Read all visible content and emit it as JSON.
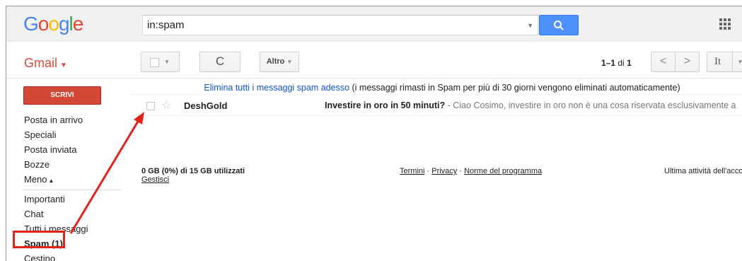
{
  "header": {
    "logo_letters": [
      {
        "ch": "G",
        "color": "#4285f4"
      },
      {
        "ch": "o",
        "color": "#ea4335"
      },
      {
        "ch": "o",
        "color": "#fbbc05"
      },
      {
        "ch": "g",
        "color": "#4285f4"
      },
      {
        "ch": "l",
        "color": "#34a853"
      },
      {
        "ch": "e",
        "color": "#ea4335"
      }
    ],
    "search_value": "in:spam",
    "search_icon": "search-icon",
    "apps_icon": "apps-grid-icon"
  },
  "toolbar": {
    "gmail_label": "Gmail",
    "refresh_glyph": "C",
    "altro_label": "Altro",
    "pager_range": "1–1",
    "pager_of": "di",
    "pager_total": "1",
    "prev_glyph": "<",
    "next_glyph": ">",
    "lang_label": "It"
  },
  "sidebar": {
    "compose_label": "SCRIVI",
    "items": [
      {
        "label": "Posta in arrivo"
      },
      {
        "label": "Speciali"
      },
      {
        "label": "Posta inviata"
      },
      {
        "label": "Bozze"
      }
    ],
    "more_label": "Meno",
    "items2": [
      {
        "label": "Importanti"
      },
      {
        "label": "Chat"
      },
      {
        "label": "Tutti i messaggi"
      },
      {
        "label": "Spam (1)"
      },
      {
        "label": "Cestino"
      }
    ]
  },
  "banner": {
    "link_text": "Elimina tutti i messaggi spam adesso",
    "rest_text": " (i messaggi rimasti in Spam per più di 30 giorni vengono eliminati automaticamente)"
  },
  "messages": [
    {
      "sender": "DeshGold",
      "subject": "Investire in oro in 50 minuti?",
      "snippet": " - Ciao Cosimo, investire in oro non è una cosa riservata esclusivamente a"
    }
  ],
  "footer": {
    "storage": "0 GB (0%) di 15 GB utilizzati",
    "manage": "Gestisci",
    "terms": "Termini",
    "sep": " · ",
    "privacy": "Privacy",
    "program": "Norme del programma",
    "activity": "Ultima attività dell'acco"
  },
  "colors": {
    "accent_red": "#dd4b39",
    "compose_red": "#d14836",
    "search_blue": "#4d90fe",
    "annotation_red": "#e2231a"
  }
}
